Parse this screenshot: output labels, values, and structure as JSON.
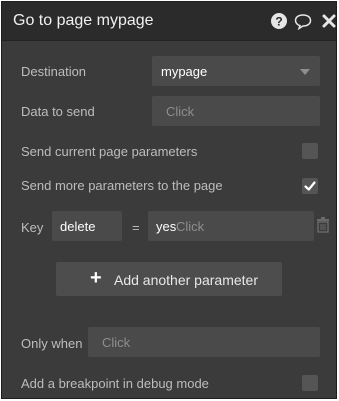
{
  "header": {
    "title": "Go to page mypage"
  },
  "destination": {
    "label": "Destination",
    "value": "mypage"
  },
  "data_to_send": {
    "label": "Data to send",
    "placeholder": "Click"
  },
  "send_current": {
    "label": "Send current page parameters",
    "checked": false
  },
  "send_more": {
    "label": "Send more parameters to the page",
    "checked": true
  },
  "parameter": {
    "key_label": "Key",
    "key_value": "delete",
    "equals": "=",
    "value": "yes",
    "value_placeholder": "Click"
  },
  "add_param": {
    "label": "Add another parameter"
  },
  "only_when": {
    "label": "Only when",
    "placeholder": "Click"
  },
  "breakpoint": {
    "label": "Add a breakpoint in debug mode",
    "checked": false
  },
  "icons": [
    "help-icon",
    "comment-icon",
    "close-icon",
    "chevron-down-icon",
    "trash-icon",
    "plus-icon",
    "checkmark-icon"
  ]
}
